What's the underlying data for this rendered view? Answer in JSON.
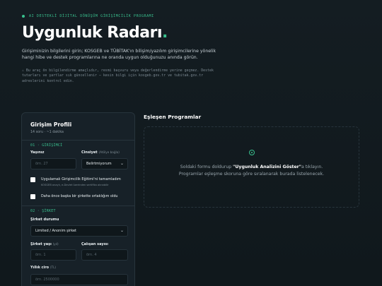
{
  "hero": {
    "kicker": "AI DESTEKLİ DİJİTAL DÖNÜŞÜM GİRİŞİMCİLİK PROGRAMI",
    "title_main": "Uygunluk Radarı",
    "title_dot": ".",
    "lead": "Girişiminizin bilgilerini girin; KOSGEB ve TÜBİTAK'ın bilişim/yazılım girişimcilerine yönelik hangi hibe ve destek programlarına ne oranda uygun olduğunuzu anında görün.",
    "note": "⚠ Bu araç ön bilgilendirme amaçlıdır, resmi başvuru veya değerlendirme yerine geçmez. Destek tutarları ve şartlar sık güncellenir — kesin bilgi için kosgeb.gov.tr ve tubitak.gov.tr adreslerini kontrol edin."
  },
  "form": {
    "title": "Girişim Profili",
    "subtitle": "14 soru · ~1 dakika",
    "section1": "01 · GİRİŞİMCİ",
    "age_label": "Yaşınız",
    "age_placeholder": "örn. 27",
    "gender_label": "Cinsiyet",
    "gender_hint": "(Atölye bağla)",
    "gender_value": "Belirtmiyorum",
    "check1_label": "Uygulamalı Girişimcilik Eğitimi'ni tamamladım",
    "check1_sub": "KOSGEB onaylı, e-Devlet üzerinden sertifika alınabilir",
    "check2_label": "Daha önce başka bir şirkette ortaklığım oldu",
    "section2": "02 · ŞİRKET",
    "company_status_label": "Şirket durumu",
    "company_status_value": "Limited / Anonim şirket",
    "company_age_label": "Şirket yaşı",
    "company_age_hint": "(yıl)",
    "company_age_placeholder": "örn. 1",
    "employees_label": "Çalışan sayısı",
    "employees_placeholder": "örn. 4",
    "revenue_label": "Yıllık ciro",
    "revenue_hint": "(TL)",
    "revenue_placeholder": "örn. 2500000"
  },
  "matches": {
    "title": "Eşleşen Programlar",
    "empty_line1_pre": "Soldaki formu doldurup ",
    "empty_line1_btn": "\"Uygunluk Analizini Göster\"",
    "empty_line1_post": "a tıklayın.",
    "empty_line2": "Programlar eşleşme skoruna göre sıralanarak burada listelenecek."
  },
  "colors": {
    "accent": "#39c08e",
    "background": "#141d22",
    "card": "#172128"
  }
}
